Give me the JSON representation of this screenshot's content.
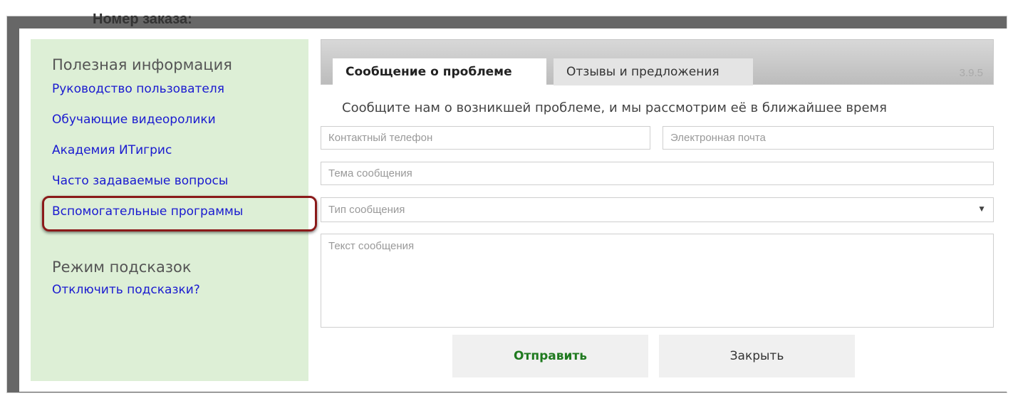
{
  "background": {
    "order_label": "Номер заказа:"
  },
  "sidebar": {
    "heading": "Полезная информация",
    "links": [
      "Руководство пользователя",
      "Обучающие видеоролики",
      "Академия ИТигрис",
      "Часто задаваемые вопросы",
      "Вспомогательные программы"
    ],
    "hints_heading": "Режим подсказок",
    "hints_link": "Отключить подсказки?"
  },
  "tabs": {
    "active": "Сообщение о проблеме",
    "inactive": "Отзывы и предложения",
    "version": "3.9.5"
  },
  "form": {
    "lead": "Сообщите нам о возникшей проблеме, и мы рассмотрим её в ближайшее время",
    "phone_placeholder": "Контактный телефон",
    "email_placeholder": "Электронная почта",
    "subject_placeholder": "Тема сообщения",
    "type_placeholder": "Тип сообщения",
    "text_placeholder": "Текст сообщения",
    "send_label": "Отправить",
    "close_label": "Закрыть"
  },
  "colors": {
    "sidebar_bg": "#ddefd6",
    "link": "#1a1ad0",
    "highlight": "#8b1a1a",
    "send": "#1f7a1f"
  }
}
